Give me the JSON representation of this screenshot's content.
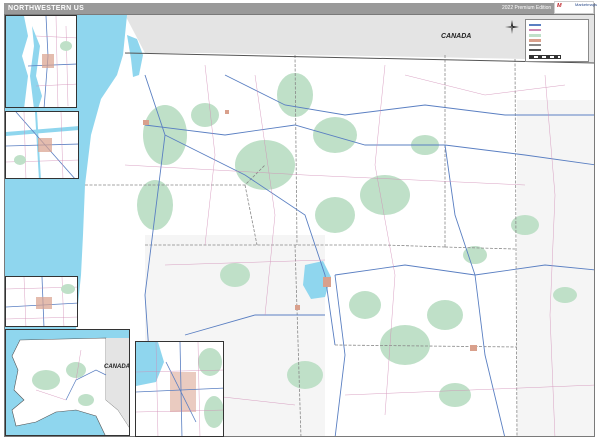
{
  "header": {
    "title": "NORTHWESTERN US",
    "edition": "2022 Premium Edition"
  },
  "logo": {
    "brand": "Marketmaps"
  },
  "labels": {
    "canada_main": "CANADA",
    "canada_alaska": "CANADA"
  },
  "legend": {
    "entries": []
  },
  "colors": {
    "water": "#8fd6ee",
    "land_us": "#ffffff",
    "land_canada": "#e4e4e4",
    "forest": "#bfe0c8",
    "roads_major": "#5a7fc2",
    "roads_minor": "#d08ab4",
    "title_bar": "#9a9a9a"
  },
  "icons": {
    "compass": "compass-rose-icon"
  }
}
